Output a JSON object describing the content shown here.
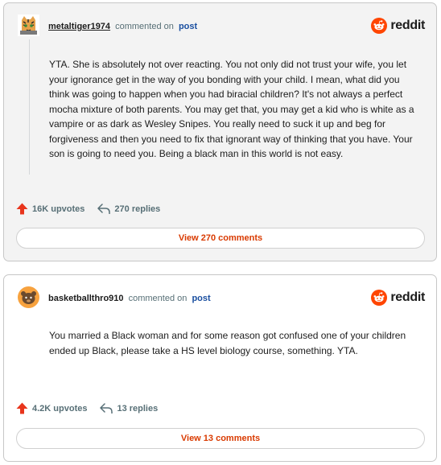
{
  "comments": [
    {
      "username": "metaltiger1974",
      "commented_on": "commented on",
      "post_link": "post",
      "brand": "reddit",
      "body": "YTA. She is absolutely not over reacting. You not only did not trust your wife, you let your ignorance get in the way of you bonding with your child. I mean, what did you think was going to happen when you had biracial children? It's not always a perfect mocha mixture of both parents. You may get that, you may get a kid who is white as a vampire or as dark as Wesley Snipes. You really need to suck it up and beg for forgiveness and then you need to fix that ignorant way of thinking that you have. Your son is going to need you. Being a black man in this world is not easy.",
      "upvotes": "16K upvotes",
      "replies": "270 replies",
      "view_button": "View 270 comments"
    },
    {
      "username": "basketballthro910",
      "commented_on": "commented on",
      "post_link": "post",
      "brand": "reddit",
      "body": "You married a Black woman and for some reason got confused one of your children ended up Black, please take a HS level biology course, something. YTA.",
      "upvotes": "4.2K upvotes",
      "replies": "13 replies",
      "view_button": "View 13 comments"
    }
  ],
  "colors": {
    "reddit_orange": "#ff4500",
    "upvote_red": "#e8351c",
    "link_blue": "#1a4fa0",
    "view_button_text": "#d93a00",
    "meta_gray": "#576f76"
  }
}
